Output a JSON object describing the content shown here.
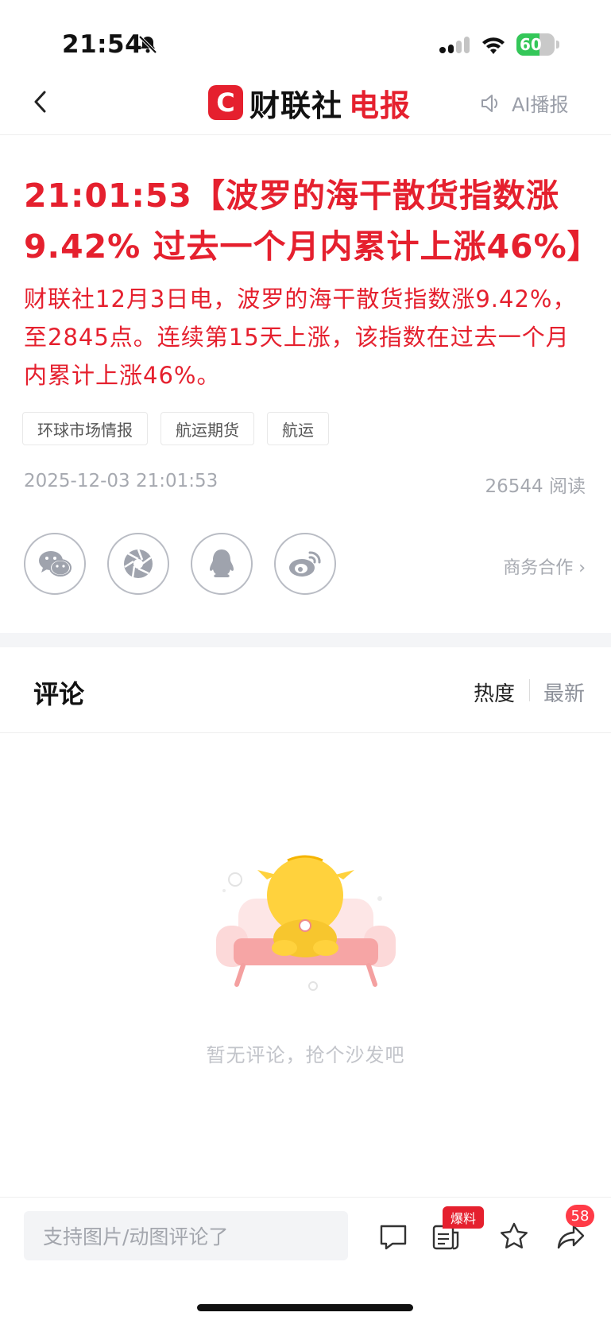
{
  "status_bar": {
    "time": "21:54",
    "battery": "60",
    "battery_level": 0.6
  },
  "nav": {
    "brand_logo": "C",
    "brand_name_a": "财联社",
    "brand_name_b": "电报",
    "ai_label": "AI播报"
  },
  "article": {
    "headline": "21:01:53【波罗的海干散货指数涨9.42% 过去一个月内累计上涨46%】",
    "body": "财联社12月3日电，波罗的海干散货指数涨9.42%，至2845点。连续第15天上涨，该指数在过去一个月内累计上涨46%。",
    "tags": [
      "环球市场情报",
      "航运期货",
      "航运"
    ],
    "time": "2025-12-03 21:01:53",
    "reads": "26544 阅读",
    "business": "商务合作 ›"
  },
  "share": {
    "icons": [
      "wechat-icon",
      "moments-icon",
      "qq-icon",
      "weibo-icon"
    ]
  },
  "comments": {
    "title": "评论",
    "sort_hot": "热度",
    "sort_new": "最新",
    "empty_text": "暂无评论，抢个沙发吧"
  },
  "bottom_bar": {
    "input_placeholder": "支持图片/动图评论了",
    "tip_badge": "爆料",
    "share_count": "58"
  },
  "colors": {
    "brand_red": "#e5202e",
    "muted": "#a6a9b0"
  }
}
